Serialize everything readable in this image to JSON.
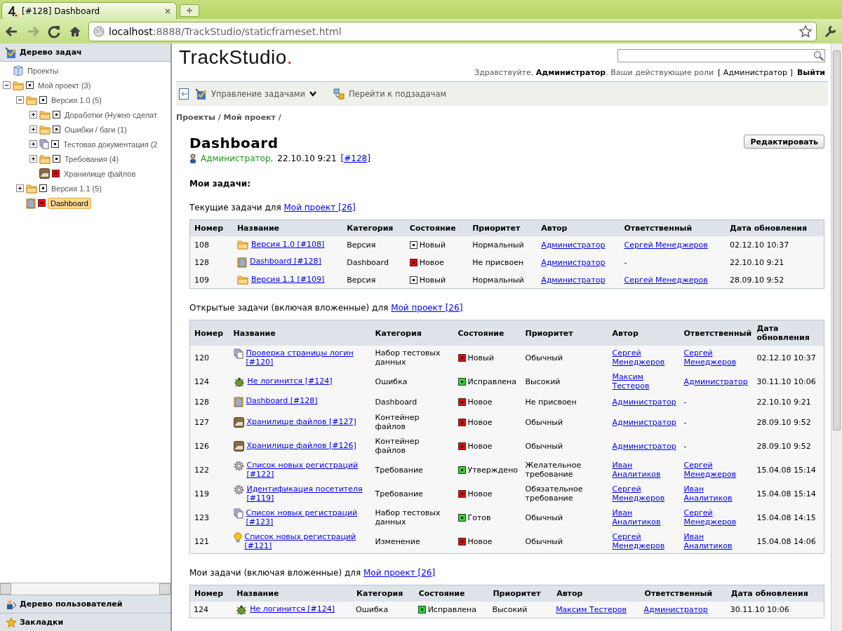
{
  "browser": {
    "tab_title": "[#128] Dashboard",
    "address_host": "localhost",
    "address_rest": ":8888/TrackStudio/staticframeset.html"
  },
  "sidebar": {
    "title": "Дерево задач",
    "tree": [
      {
        "label": "Проекты",
        "kind": "projects",
        "children": [
          {
            "label": "Мой проект (3)",
            "kind": "folder",
            "color": "#ffffff",
            "expanded": true,
            "selected": false,
            "children": [
              {
                "label": "Версия 1.0 (5)",
                "kind": "folder",
                "color": "#ffffff",
                "expanded": true,
                "selected": false,
                "children": [
                  {
                    "label": "Доработки (Нужно сделат",
                    "kind": "folder",
                    "color": "#ffffff",
                    "expanded": false,
                    "selected": false
                  },
                  {
                    "label": "Ошибки / баги (1)",
                    "kind": "folder",
                    "color": "#ffffff",
                    "expanded": false,
                    "selected": false
                  },
                  {
                    "label": "Тестовая документация (2",
                    "kind": "pages",
                    "color": "#ffffff",
                    "expanded": false,
                    "selected": false
                  },
                  {
                    "label": "Требования (4)",
                    "kind": "folder",
                    "color": "#ffffff",
                    "expanded": false,
                    "selected": false
                  },
                  {
                    "label": "Хранилище файлов",
                    "kind": "storage",
                    "color": "#ff0000",
                    "selected": false
                  }
                ]
              },
              {
                "label": "Версия 1.1 (5)",
                "kind": "folder",
                "color": "#ffffff",
                "expanded": false,
                "selected": false
              },
              {
                "label": "Dashboard",
                "kind": "dashboard",
                "color": "#ff0000",
                "selected": true
              }
            ]
          }
        ]
      }
    ],
    "panels": [
      "Дерево пользователей",
      "Закладки"
    ]
  },
  "header": {
    "logo": "TrackStudio",
    "logo_dot": ".",
    "greeting": "Здравствуйте, **Администратор**. Ваши действующие роли",
    "roles": "[ Администратор ]",
    "logout": "Выйти"
  },
  "toolbar": [
    "Управление задачами",
    "Перейти к подзадачам"
  ],
  "breadcrumb": "Проекты / Мой проект /",
  "task": {
    "title": "Dashboard",
    "author": "Администратор,",
    "date": "22.10.10 9:21",
    "link": "[#128]",
    "edit_button": "Редактировать"
  },
  "section_title": "Мои задачи:",
  "tables": [
    {
      "caption": "Текущие задачи для",
      "caption_link": "Мой проект [26]",
      "columns": [
        "Номер",
        "Название",
        "Категория",
        "Состояние",
        "Приоритет",
        "Автор",
        "Ответственный",
        "Дата обновления"
      ],
      "rows": [
        {
          "number": "108",
          "kind": "folder",
          "name": "Версия 1.0 [#108]",
          "category": "Версия",
          "status": "Новый",
          "color": "#ffffff",
          "priority": "Нормальный",
          "author": "Администратор",
          "assignee": "Сергей Менеджеров",
          "assignee_link": true,
          "date": "02.12.10 10:37"
        },
        {
          "number": "128",
          "kind": "dashboard",
          "name": "Dashboard [#128]",
          "category": "Dashboard",
          "status": "Новое",
          "color": "#ee0000",
          "priority": "Не присвоен",
          "author": "Администратор",
          "assignee": "-",
          "assignee_link": false,
          "date": "22.10.10 9:21"
        },
        {
          "number": "109",
          "kind": "folder",
          "name": "Версия 1.1 [#109]",
          "category": "Версия",
          "status": "Новый",
          "color": "#ffffff",
          "priority": "Нормальный",
          "author": "Администратор",
          "assignee": "Сергей Менеджеров",
          "assignee_link": true,
          "date": "28.09.10 9:52"
        }
      ]
    },
    {
      "caption": "Открытые задачи (включая вложенные) для",
      "caption_link": "Мой проект [26]",
      "columns": [
        "Номер",
        "Название",
        "Категория",
        "Состояние",
        "Приоритет",
        "Автор",
        "Ответственный",
        "Дата обновления"
      ],
      "rows": [
        {
          "number": "120",
          "kind": "pages",
          "name": "Проверка страницы логин [#120]",
          "category": "Набор тестовых данных",
          "status": "Новый",
          "color": "#ee0000",
          "priority": "Обычный",
          "author": "Сергей Менеджеров",
          "assignee": "Сергей Менеджеров",
          "assignee_link": true,
          "date": "02.12.10 10:37"
        },
        {
          "number": "124",
          "kind": "bug",
          "name": "Не логинится [#124]",
          "category": "Ошибка",
          "status": "Исправлена",
          "color": "#22dd22",
          "priority": "Высокий",
          "author": "Максим Тестеров",
          "assignee": "Администратор",
          "assignee_link": true,
          "date": "30.11.10 10:06"
        },
        {
          "number": "128",
          "kind": "dashboard",
          "name": "Dashboard [#128]",
          "category": "Dashboard",
          "status": "Новое",
          "color": "#ee0000",
          "priority": "Не присвоен",
          "author": "Администратор",
          "assignee": "-",
          "assignee_link": false,
          "date": "22.10.10 9:21"
        },
        {
          "number": "127",
          "kind": "storage",
          "name": "Хранилище файлов [#127]",
          "category": "Контейнер файлов",
          "status": "Новое",
          "color": "#ee0000",
          "priority": "Обычный",
          "author": "Администратор",
          "assignee": "-",
          "assignee_link": false,
          "date": "28.09.10 9:52"
        },
        {
          "number": "126",
          "kind": "storage",
          "name": "Хранилище файлов [#126]",
          "category": "Контейнер файлов",
          "status": "Новое",
          "color": "#ee0000",
          "priority": "Обычный",
          "author": "Администратор",
          "assignee": "-",
          "assignee_link": false,
          "date": "28.09.10 9:52"
        },
        {
          "number": "122",
          "kind": "gear",
          "name": "Список новых регистраций [#122]",
          "category": "Требование",
          "status": "Утверждено",
          "color": "#22dd22",
          "priority": "Желательное требование",
          "author": "Иван Аналитиков",
          "assignee": "Сергей Менеджеров",
          "assignee_link": true,
          "date": "15.04.08 15:14"
        },
        {
          "number": "119",
          "kind": "gear",
          "name": "Идентификация посетителя [#119]",
          "category": "Требование",
          "status": "Новое",
          "color": "#ee0000",
          "priority": "Обязательное требование",
          "author": "Сергей Менеджеров",
          "assignee": "Иван Аналитиков",
          "assignee_link": true,
          "date": "15.04.08 15:14"
        },
        {
          "number": "123",
          "kind": "pages",
          "name": "Список новых регистраций [#123]",
          "category": "Набор тестовых данных",
          "status": "Готов",
          "color": "#22dd22",
          "priority": "Обычный",
          "author": "Иван Аналитиков",
          "assignee": "Сергей Менеджеров",
          "assignee_link": true,
          "date": "15.04.08 14:15"
        },
        {
          "number": "121",
          "kind": "bulb",
          "name": "Список новых регистраций [#121]",
          "category": "Изменение",
          "status": "Новое",
          "color": "#ee0000",
          "priority": "Обычный",
          "author": "Сергей Менеджеров",
          "assignee": "Иван Аналитиков",
          "assignee_link": true,
          "date": "15.04.08 14:06"
        }
      ]
    },
    {
      "caption": "Мои задачи (включая вложенные) для",
      "caption_link": "Мой проект [26]",
      "columns": [
        "Номер",
        "Название",
        "Категория",
        "Состояние",
        "Приоритет",
        "Автор",
        "Ответственный",
        "Дата обновления"
      ],
      "rows": [
        {
          "number": "124",
          "kind": "bug",
          "name": "Не логинится [#124]",
          "category": "Ошибка",
          "status": "Исправлена",
          "color": "#22dd22",
          "priority": "Высокий",
          "author": "Максим Тестеров",
          "assignee": "Администратор",
          "assignee_link": true,
          "date": "30.11.10 10:06"
        }
      ]
    }
  ]
}
